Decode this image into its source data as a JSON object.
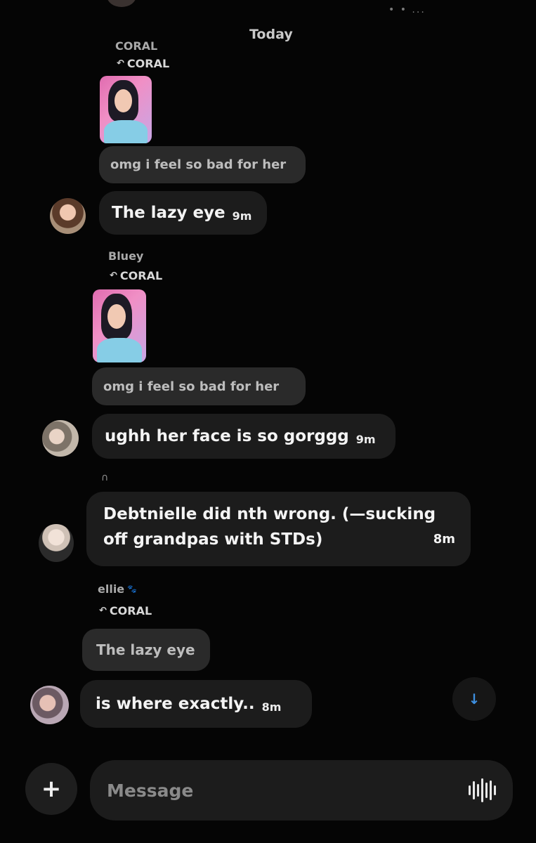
{
  "day_separator": "Today",
  "top_status": "• • ...",
  "messages": [
    {
      "reply_author": "CORAL",
      "reply_to": "CORAL",
      "quoted_text": "omg i feel so bad for her"
    },
    {
      "text": "The lazy eye",
      "time": "9m"
    },
    {
      "reply_author": "Bluey",
      "reply_to": "CORAL",
      "quoted_text": "omg i feel so bad for her"
    },
    {
      "text": "ughh her face is so gorggg",
      "time": "9m"
    },
    {
      "reply_mark": "∩",
      "text_line1": "Debtnielle did nth wrong. (—sucking",
      "text_line2": "off grandpas with STDs)",
      "time": "8m"
    },
    {
      "reply_author": "ellie",
      "reply_to": "CORAL",
      "quoted_text": "The lazy eye"
    },
    {
      "text": "is where exactly..",
      "time": "8m"
    }
  ],
  "composer": {
    "placeholder": "Message"
  },
  "icons": {
    "reply": "reply-arrow-icon",
    "scroll": "arrow-down-icon",
    "add": "plus-icon",
    "voice": "waveform-icon",
    "paw": "paw-icon"
  },
  "colors": {
    "background": "#050505",
    "bubble": "#1c1c1c",
    "quote_bubble": "#2a2a2a",
    "accent": "#3d8fe0"
  }
}
